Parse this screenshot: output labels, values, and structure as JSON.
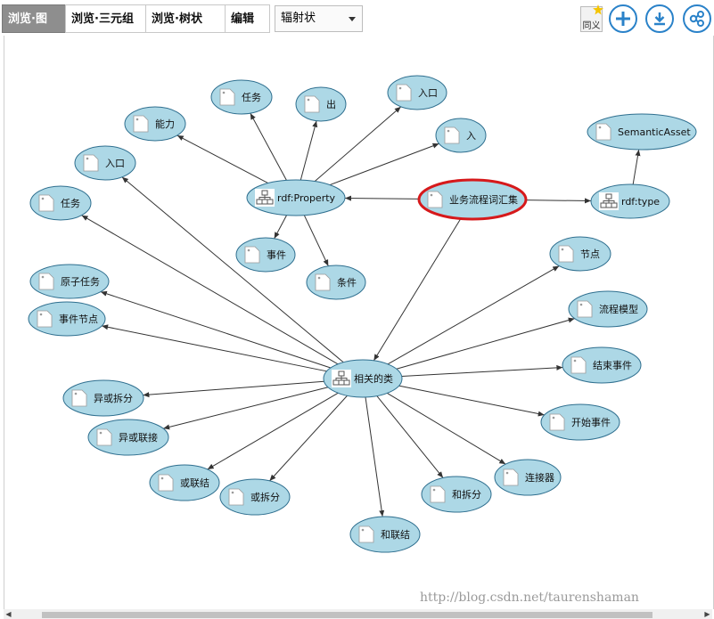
{
  "tabs": [
    {
      "label": "浏览·图",
      "active": true
    },
    {
      "label": "浏览·三元组",
      "active": false
    },
    {
      "label": "浏览·树状",
      "active": false
    },
    {
      "label": "编辑",
      "active": false
    }
  ],
  "layout_select": {
    "value": "辐射状"
  },
  "toolbar_buttons": {
    "synonym_label": "同义",
    "add": "add-icon",
    "download": "download-icon",
    "share": "share-icon"
  },
  "graph": {
    "nodes": [
      {
        "id": "center",
        "label": "业务流程词汇集",
        "kind": "concept",
        "highlight": true
      },
      {
        "id": "rdfprop",
        "label": "rdf:Property",
        "kind": "class"
      },
      {
        "id": "rdftype",
        "label": "rdf:type",
        "kind": "class"
      },
      {
        "id": "semasset",
        "label": "SemanticAsset",
        "kind": "concept"
      },
      {
        "id": "related",
        "label": "相关的类",
        "kind": "class"
      },
      {
        "id": "p_renwu",
        "label": "任务",
        "kind": "concept"
      },
      {
        "id": "p_chu",
        "label": "出",
        "kind": "concept"
      },
      {
        "id": "p_rukou",
        "label": "入口",
        "kind": "concept"
      },
      {
        "id": "p_ru",
        "label": "入",
        "kind": "concept"
      },
      {
        "id": "p_nengli",
        "label": "能力",
        "kind": "concept"
      },
      {
        "id": "p_shijian",
        "label": "事件",
        "kind": "concept"
      },
      {
        "id": "p_tiaojian",
        "label": "条件",
        "kind": "concept"
      },
      {
        "id": "r_rukou",
        "label": "入口",
        "kind": "concept"
      },
      {
        "id": "r_renwu",
        "label": "任务",
        "kind": "concept"
      },
      {
        "id": "r_yuanzi",
        "label": "原子任务",
        "kind": "concept"
      },
      {
        "id": "r_shijianjd",
        "label": "事件节点",
        "kind": "concept"
      },
      {
        "id": "r_yihuocf",
        "label": "异或拆分",
        "kind": "concept"
      },
      {
        "id": "r_yihuolj",
        "label": "异或联接",
        "kind": "concept"
      },
      {
        "id": "r_huolj",
        "label": "或联结",
        "kind": "concept"
      },
      {
        "id": "r_huocf",
        "label": "或拆分",
        "kind": "concept"
      },
      {
        "id": "r_helj",
        "label": "和联结",
        "kind": "concept"
      },
      {
        "id": "r_hecf",
        "label": "和拆分",
        "kind": "concept"
      },
      {
        "id": "r_ljq",
        "label": "连接器",
        "kind": "concept"
      },
      {
        "id": "r_kssj",
        "label": "开始事件",
        "kind": "concept"
      },
      {
        "id": "r_jssj",
        "label": "结束事件",
        "kind": "concept"
      },
      {
        "id": "r_lcmx",
        "label": "流程模型",
        "kind": "concept"
      },
      {
        "id": "r_jd",
        "label": "节点",
        "kind": "concept"
      }
    ],
    "edges": [
      [
        "center",
        "rdfprop"
      ],
      [
        "center",
        "rdftype"
      ],
      [
        "rdftype",
        "semasset"
      ],
      [
        "center",
        "related"
      ],
      [
        "rdfprop",
        "p_renwu"
      ],
      [
        "rdfprop",
        "p_chu"
      ],
      [
        "rdfprop",
        "p_rukou"
      ],
      [
        "rdfprop",
        "p_ru"
      ],
      [
        "rdfprop",
        "p_nengli"
      ],
      [
        "rdfprop",
        "p_shijian"
      ],
      [
        "rdfprop",
        "p_tiaojian"
      ],
      [
        "related",
        "r_rukou"
      ],
      [
        "related",
        "r_renwu"
      ],
      [
        "related",
        "r_yuanzi"
      ],
      [
        "related",
        "r_shijianjd"
      ],
      [
        "related",
        "r_yihuocf"
      ],
      [
        "related",
        "r_yihuolj"
      ],
      [
        "related",
        "r_huolj"
      ],
      [
        "related",
        "r_huocf"
      ],
      [
        "related",
        "r_helj"
      ],
      [
        "related",
        "r_hecf"
      ],
      [
        "related",
        "r_ljq"
      ],
      [
        "related",
        "r_kssj"
      ],
      [
        "related",
        "r_jssj"
      ],
      [
        "related",
        "r_lcmx"
      ],
      [
        "related",
        "r_jd"
      ]
    ]
  },
  "watermark": "http://blog.csdn.net/taurenshaman",
  "colors": {
    "node_fill": "#add8e6",
    "node_stroke": "#2f6f8f",
    "highlight": "#d6191b",
    "edge": "#333333"
  }
}
